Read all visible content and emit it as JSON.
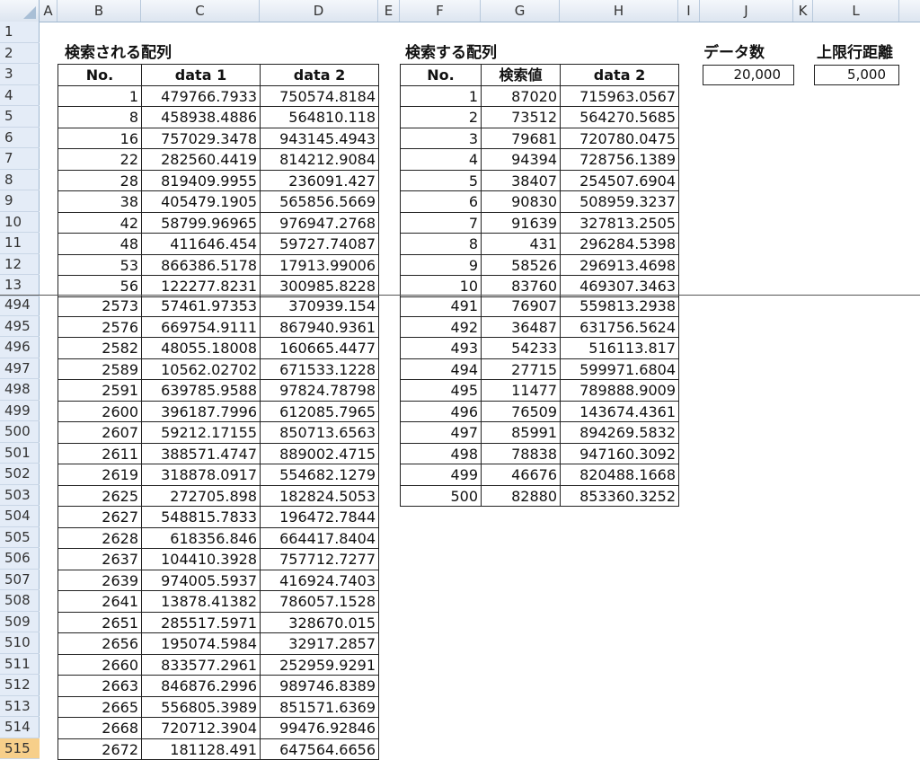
{
  "columns": [
    "A",
    "B",
    "C",
    "D",
    "E",
    "F",
    "G",
    "H",
    "I",
    "J",
    "K",
    "L"
  ],
  "rows_top": [
    "1",
    "2",
    "3",
    "4",
    "5",
    "6",
    "7",
    "8",
    "9",
    "10",
    "11",
    "12",
    "13"
  ],
  "rows_bottom": [
    "494",
    "495",
    "496",
    "497",
    "498",
    "499",
    "500",
    "501",
    "502",
    "503",
    "504",
    "505",
    "506",
    "507",
    "508",
    "509",
    "510",
    "511",
    "512",
    "513",
    "514",
    "515"
  ],
  "searched_title": "検索される配列",
  "search_title": "検索する配列",
  "data_count_label": "データ数",
  "upper_limit_label": "上限行距離",
  "data_count_value": "20,000",
  "upper_limit_value": "5,000",
  "searched_headers": [
    "No.",
    "data 1",
    "data 2"
  ],
  "search_headers": [
    "No.",
    "検索値",
    "data 2"
  ],
  "searched_top": [
    [
      "1",
      "479766.7933",
      "750574.8184"
    ],
    [
      "8",
      "458938.4886",
      "564810.118"
    ],
    [
      "16",
      "757029.3478",
      "943145.4943"
    ],
    [
      "22",
      "282560.4419",
      "814212.9084"
    ],
    [
      "28",
      "819409.9955",
      "236091.427"
    ],
    [
      "38",
      "405479.1905",
      "565856.5669"
    ],
    [
      "42",
      "58799.96965",
      "976947.2768"
    ],
    [
      "48",
      "411646.454",
      "59727.74087"
    ],
    [
      "53",
      "866386.5178",
      "17913.99006"
    ],
    [
      "56",
      "122277.8231",
      "300985.8228"
    ]
  ],
  "searched_bottom": [
    [
      "2573",
      "57461.97353",
      "370939.154"
    ],
    [
      "2576",
      "669754.9111",
      "867940.9361"
    ],
    [
      "2582",
      "48055.18008",
      "160665.4477"
    ],
    [
      "2589",
      "10562.02702",
      "671533.1228"
    ],
    [
      "2591",
      "639785.9588",
      "97824.78798"
    ],
    [
      "2600",
      "396187.7996",
      "612085.7965"
    ],
    [
      "2607",
      "59212.17155",
      "850713.6563"
    ],
    [
      "2611",
      "388571.4747",
      "889002.4715"
    ],
    [
      "2619",
      "318878.0917",
      "554682.1279"
    ],
    [
      "2625",
      "272705.898",
      "182824.5053"
    ],
    [
      "2627",
      "548815.7833",
      "196472.7844"
    ],
    [
      "2628",
      "618356.846",
      "664417.8404"
    ],
    [
      "2637",
      "104410.3928",
      "757712.7277"
    ],
    [
      "2639",
      "974005.5937",
      "416924.7403"
    ],
    [
      "2641",
      "13878.41382",
      "786057.1528"
    ],
    [
      "2651",
      "285517.5971",
      "328670.015"
    ],
    [
      "2656",
      "195074.5984",
      "32917.2857"
    ],
    [
      "2660",
      "833577.2961",
      "252959.9291"
    ],
    [
      "2663",
      "846876.2996",
      "989746.8389"
    ],
    [
      "2665",
      "556805.3989",
      "851571.6369"
    ],
    [
      "2668",
      "720712.3904",
      "99476.92846"
    ],
    [
      "2672",
      "181128.491",
      "647564.6656"
    ]
  ],
  "search_top": [
    [
      "1",
      "87020",
      "715963.0567"
    ],
    [
      "2",
      "73512",
      "564270.5685"
    ],
    [
      "3",
      "79681",
      "720780.0475"
    ],
    [
      "4",
      "94394",
      "728756.1389"
    ],
    [
      "5",
      "38407",
      "254507.6904"
    ],
    [
      "6",
      "90830",
      "508959.3237"
    ],
    [
      "7",
      "91639",
      "327813.2505"
    ],
    [
      "8",
      "431",
      "296284.5398"
    ],
    [
      "9",
      "58526",
      "296913.4698"
    ],
    [
      "10",
      "83760",
      "469307.3463"
    ]
  ],
  "search_bottom": [
    [
      "491",
      "76907",
      "559813.2938"
    ],
    [
      "492",
      "36487",
      "631756.5624"
    ],
    [
      "493",
      "54233",
      "516113.817"
    ],
    [
      "494",
      "27715",
      "599971.6804"
    ],
    [
      "495",
      "11477",
      "789888.9009"
    ],
    [
      "496",
      "76509",
      "143674.4361"
    ],
    [
      "497",
      "85991",
      "894269.5832"
    ],
    [
      "498",
      "78838",
      "947160.3092"
    ],
    [
      "499",
      "46676",
      "820488.1668"
    ],
    [
      "500",
      "82880",
      "853360.3252"
    ]
  ]
}
